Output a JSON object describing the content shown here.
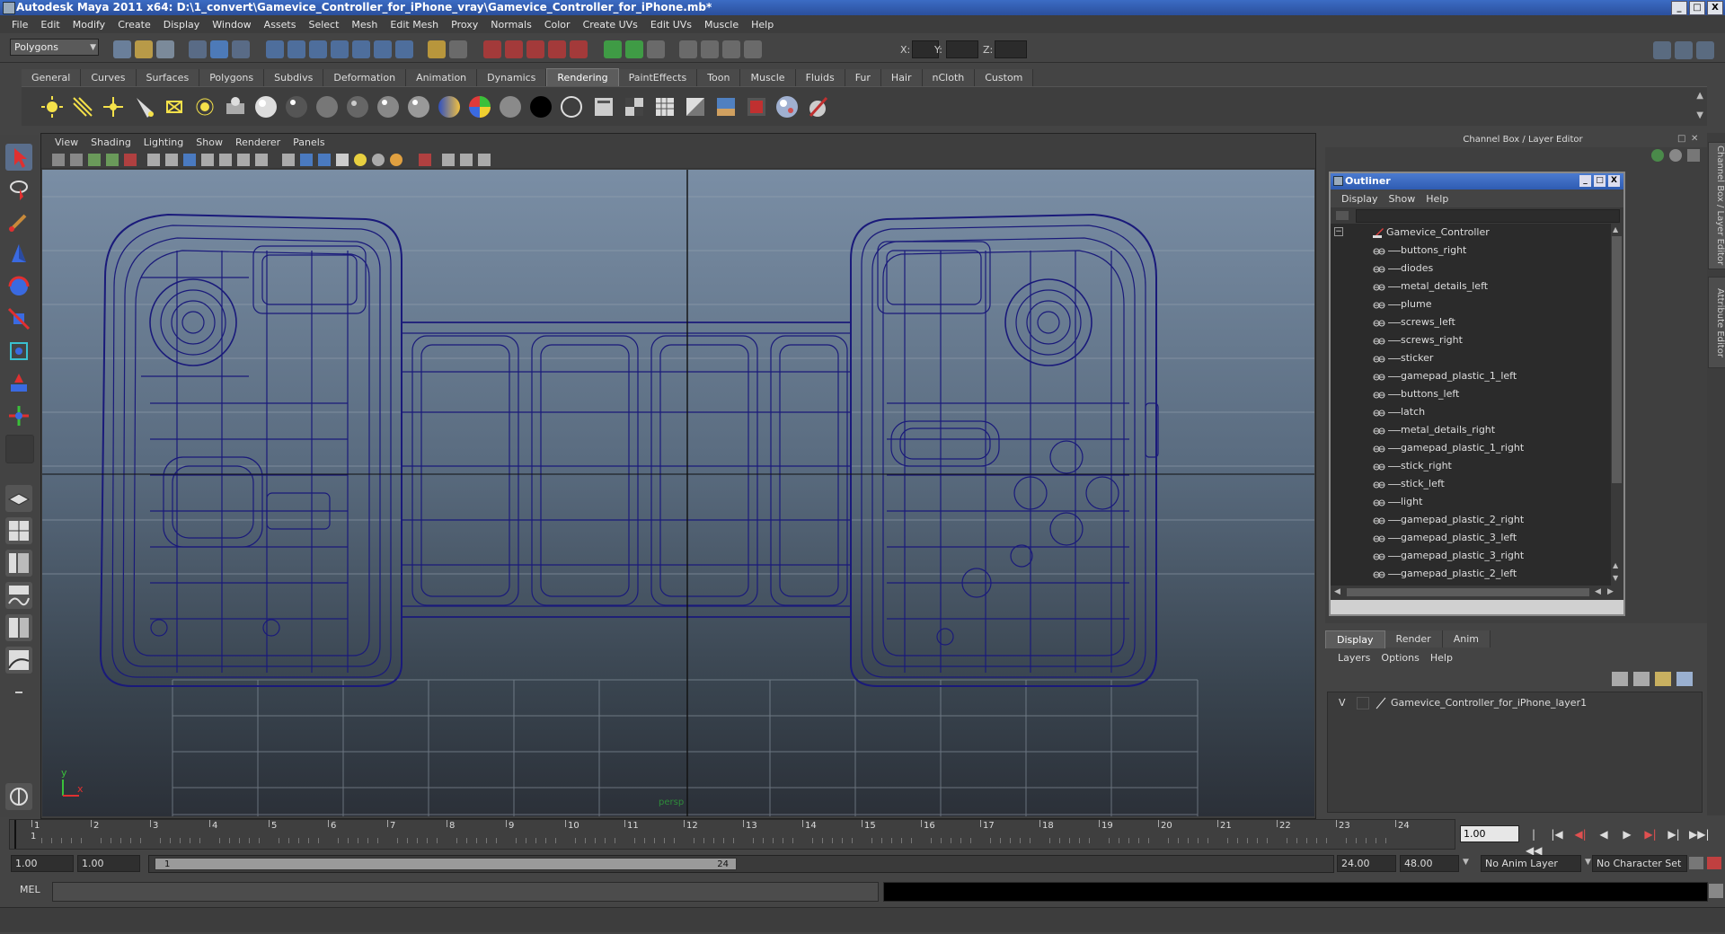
{
  "window": {
    "title": "Autodesk Maya 2011 x64: D:\\1_convert\\Gamevice_Controller_for_iPhone_vray\\Gamevice_Controller_for_iPhone.mb*",
    "min": "_",
    "max": "□",
    "close": "X"
  },
  "menubar": [
    "File",
    "Edit",
    "Modify",
    "Create",
    "Display",
    "Window",
    "Assets",
    "Select",
    "Mesh",
    "Edit Mesh",
    "Proxy",
    "Normals",
    "Color",
    "Create UVs",
    "Edit UVs",
    "Muscle",
    "Help"
  ],
  "status": {
    "mode": "Polygons",
    "x_label": "X:",
    "y_label": "Y:",
    "z_label": "Z:"
  },
  "shelf": {
    "tabs": [
      "General",
      "Curves",
      "Surfaces",
      "Polygons",
      "Subdivs",
      "Deformation",
      "Animation",
      "Dynamics",
      "Rendering",
      "PaintEffects",
      "Toon",
      "Muscle",
      "Fluids",
      "Fur",
      "Hair",
      "nCloth",
      "Custom"
    ],
    "active": "Rendering"
  },
  "panel": {
    "menus": [
      "View",
      "Shading",
      "Lighting",
      "Show",
      "Renderer",
      "Panels"
    ],
    "camera": "persp",
    "axis_y": "y",
    "axis_x": "x"
  },
  "channelbox": {
    "title": "Channel Box / Layer Editor"
  },
  "outliner": {
    "title": "Outliner",
    "menus": [
      "Display",
      "Show",
      "Help"
    ],
    "root": "Gamevice_Controller",
    "expander": "−",
    "children": [
      "buttons_right",
      "diodes",
      "metal_details_left",
      "plume",
      "screws_left",
      "screws_right",
      "sticker",
      "gamepad_plastic_1_left",
      "buttons_left",
      "latch",
      "metal_details_right",
      "gamepad_plastic_1_right",
      "stick_right",
      "stick_left",
      "light",
      "gamepad_plastic_2_right",
      "gamepad_plastic_3_left",
      "gamepad_plastic_3_right",
      "gamepad_plastic_2_left"
    ]
  },
  "layer_editor": {
    "tabs": [
      "Display",
      "Render",
      "Anim"
    ],
    "active": "Display",
    "menus": [
      "Layers",
      "Options",
      "Help"
    ],
    "layer_visible": "V",
    "layer_name": "Gamevice_Controller_for_iPhone_layer1"
  },
  "side_tabs": [
    "Channel Box / Layer Editor",
    "Attribute Editor"
  ],
  "timeline": {
    "ticks": [
      1,
      2,
      3,
      4,
      5,
      6,
      7,
      8,
      9,
      10,
      11,
      12,
      13,
      14,
      15,
      16,
      17,
      18,
      19,
      20,
      21,
      22,
      23,
      24
    ],
    "current_frame_marker": "1",
    "current_frame": "1.00",
    "playback": [
      "|◀◀",
      "|◀",
      "◀|",
      "◀",
      "▶",
      "▶|",
      "▶|",
      "▶▶|"
    ]
  },
  "range": {
    "start": "1.00",
    "playback_start": "1.00",
    "slider_start": "1",
    "slider_end": "24",
    "playback_end": "24.00",
    "end": "48.00",
    "anim_layer": "No Anim Layer",
    "character_set": "No Character Set"
  },
  "command_line": {
    "label": "MEL"
  },
  "colors": {
    "wireframe": "#1a1a7a",
    "grid": "#9aa6b2",
    "axis": "#111111",
    "outliner_title": "#3a66c0"
  }
}
